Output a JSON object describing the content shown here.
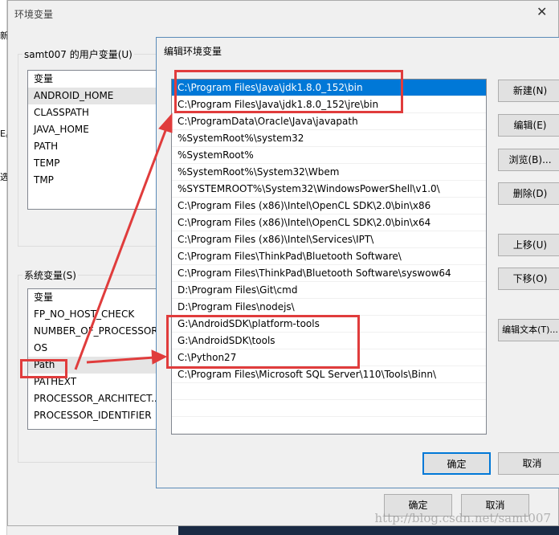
{
  "background_window": {
    "title": "环境变量",
    "close_icon": "close-icon",
    "strip_text": [
      "新",
      "E。",
      "选"
    ],
    "user_vars": {
      "label": "samt007 的用户变量(U)",
      "header": "变量",
      "items": [
        "ANDROID_HOME",
        "CLASSPATH",
        "JAVA_HOME",
        "PATH",
        "TEMP",
        "TMP"
      ]
    },
    "system_vars": {
      "label": "系统变量(S)",
      "header": "变量",
      "items": [
        "FP_NO_HOST_CHECK",
        "NUMBER_OF_PROCESSORS",
        "OS",
        "Path",
        "PATHEXT",
        "PROCESSOR_ARCHITECT...",
        "PROCESSOR_IDENTIFIER"
      ],
      "highlighted": "Path"
    },
    "ok": "确定",
    "cancel": "取消"
  },
  "edit_dialog": {
    "title": "编辑环境变量",
    "paths": [
      "C:\\Program Files\\Java\\jdk1.8.0_152\\bin",
      "C:\\Program Files\\Java\\jdk1.8.0_152\\jre\\bin",
      "C:\\ProgramData\\Oracle\\Java\\javapath",
      "%SystemRoot%\\system32",
      "%SystemRoot%",
      "%SystemRoot%\\System32\\Wbem",
      "%SYSTEMROOT%\\System32\\WindowsPowerShell\\v1.0\\",
      "C:\\Program Files (x86)\\Intel\\OpenCL SDK\\2.0\\bin\\x86",
      "C:\\Program Files (x86)\\Intel\\OpenCL SDK\\2.0\\bin\\x64",
      "C:\\Program Files (x86)\\Intel\\Services\\IPT\\",
      "C:\\Program Files\\ThinkPad\\Bluetooth Software\\",
      "C:\\Program Files\\ThinkPad\\Bluetooth Software\\syswow64",
      "D:\\Program Files\\Git\\cmd",
      "D:\\Program Files\\nodejs\\",
      "G:\\AndroidSDK\\platform-tools",
      "G:\\AndroidSDK\\tools",
      "C:\\Python27",
      "C:\\Program Files\\Microsoft SQL Server\\110\\Tools\\Binn\\"
    ],
    "selected_index": 0,
    "buttons": {
      "new": "新建(N)",
      "edit": "编辑(E)",
      "browse": "浏览(B)...",
      "delete": "删除(D)",
      "move_up": "上移(U)",
      "move_down": "下移(O)",
      "edit_text": "编辑文本(T)..."
    },
    "ok": "确定",
    "cancel": "取消"
  },
  "colors": {
    "selection": "#0078d7",
    "annotation": "#e03c3c"
  },
  "watermark": "http://blog.csdn.net/samt007"
}
